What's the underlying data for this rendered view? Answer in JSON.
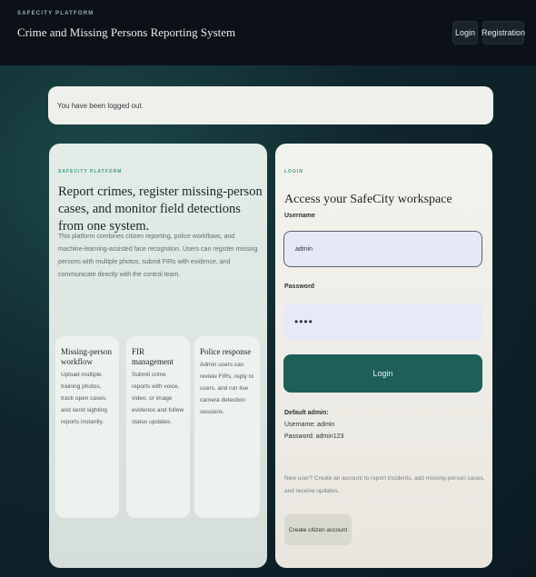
{
  "header": {
    "eyebrow": "SAFECITY PLATFORM",
    "title": "Crime and Missing Persons Reporting System",
    "nav": {
      "login": "Login",
      "register": "Registration"
    }
  },
  "alert": {
    "message": "You have been logged out."
  },
  "hero": {
    "eyebrow": "SAFECITY PLATFORM",
    "title": "Report crimes, register missing-person cases, and monitor field detections from one system.",
    "description": "This platform combines citizen reporting, police workflows, and machine-learning-assisted face recognition. Users can register missing persons with multiple photos, submit FIRs with evidence, and communicate directly with the control team."
  },
  "features": [
    {
      "title": "Missing-person workflow",
      "text": "Upload multiple training photos, track open cases, and send sighting reports instantly."
    },
    {
      "title": "FIR management",
      "text": "Submit crime reports with voice, video, or image evidence and follow status updates."
    },
    {
      "title": "Police response",
      "text": "Admin users can review FIRs, reply to users, and run live camera detection sessions."
    }
  ],
  "login": {
    "eyebrow": "LOGIN",
    "title": "Access your SafeCity workspace",
    "username_label": "Username",
    "username_value": "admin",
    "password_label": "Password",
    "password_value": "••••",
    "submit_label": "Login",
    "defaults_title": "Default admin:",
    "defaults_username": "Username: admin",
    "defaults_password": "Password: admin123",
    "signup_note": "New user? Create an account to report incidents, add missing-person cases, and receive updates.",
    "create_label": "Create citizen account"
  },
  "colors": {
    "accent": "#1e5f58",
    "eyebrow": "#3d9a82",
    "topbar": "#0c1118"
  }
}
